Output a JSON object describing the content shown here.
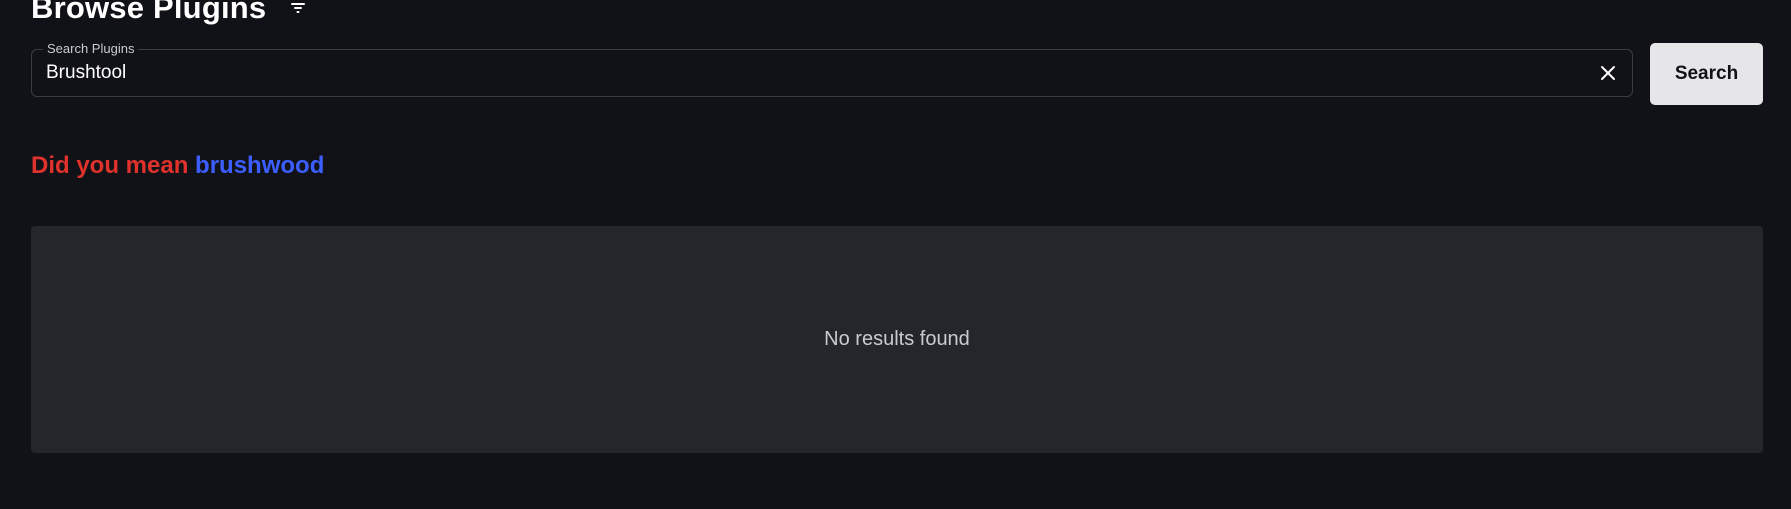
{
  "header": {
    "title": "Browse Plugins",
    "filter_icon": "filter-icon"
  },
  "search": {
    "legend": "Search Plugins",
    "value": "Brushtool",
    "clear_icon": "close-icon",
    "button_label": "Search"
  },
  "suggestion": {
    "prefix": "Did you mean",
    "term": "brushwood",
    "prefix_color": "#e0322c",
    "term_color": "#3d5eff"
  },
  "results": {
    "empty_message": "No results found"
  }
}
